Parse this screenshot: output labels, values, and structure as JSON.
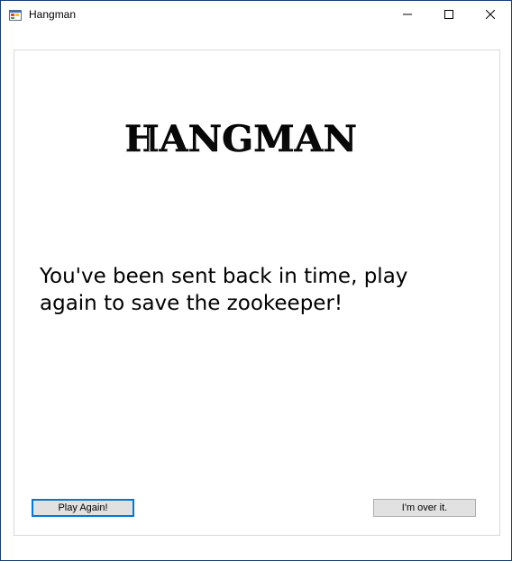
{
  "window": {
    "title": "Hangman",
    "app_icon": "windows-form-icon",
    "controls": {
      "minimize_icon": "minimize-icon",
      "maximize_icon": "maximize-icon",
      "close_icon": "close-icon"
    }
  },
  "main": {
    "logo_text": "HANGMAN",
    "message": "You've been sent back in time, play again to save the zookeeper!",
    "play_again_label": "Play Again!",
    "quit_label": "I'm over it."
  },
  "colors": {
    "window_border": "#1b3d6e",
    "focus_border": "#0078d7",
    "button_bg": "#e1e1e1"
  }
}
